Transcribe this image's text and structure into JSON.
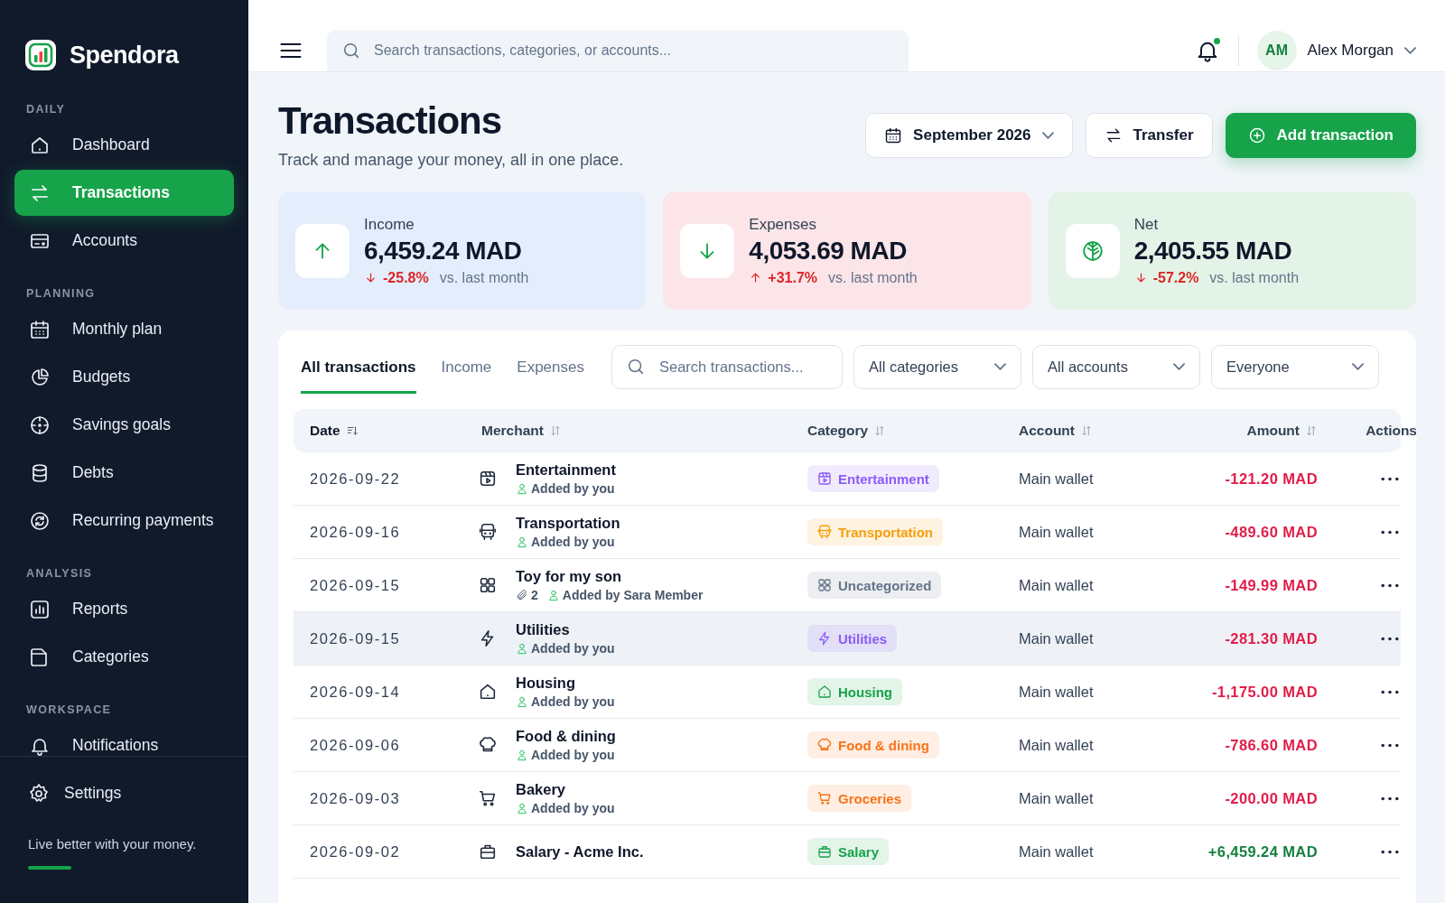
{
  "app": {
    "name": "Spendora",
    "tagline": "Live better with your money."
  },
  "sidebar": {
    "sections": [
      {
        "title": "DAILY",
        "items": [
          {
            "label": "Dashboard",
            "selected": false
          },
          {
            "label": "Transactions",
            "selected": true
          },
          {
            "label": "Accounts",
            "selected": false
          }
        ]
      },
      {
        "title": "PLANNING",
        "items": [
          {
            "label": "Monthly plan",
            "selected": false
          },
          {
            "label": "Budgets",
            "selected": false
          },
          {
            "label": "Savings goals",
            "selected": false
          },
          {
            "label": "Debts",
            "selected": false
          },
          {
            "label": "Recurring payments",
            "selected": false
          }
        ]
      },
      {
        "title": "ANALYSIS",
        "items": [
          {
            "label": "Reports",
            "selected": false
          },
          {
            "label": "Categories",
            "selected": false
          }
        ]
      },
      {
        "title": "WORKSPACE",
        "items": [
          {
            "label": "Notifications",
            "selected": false
          }
        ]
      }
    ],
    "footer_items": [
      {
        "label": "Settings",
        "selected": false
      }
    ]
  },
  "header": {
    "search": {
      "placeholder": "Search transactions, categories, or accounts..."
    },
    "notifications": {
      "unread": true
    },
    "user": {
      "initials": "AM",
      "name": "Alex Morgan"
    }
  },
  "page": {
    "title": "Transactions",
    "subtitle": "Track and manage your money, all in one place.",
    "period": "September 2026",
    "transfer_button": "Transfer",
    "add_button": "Add transaction"
  },
  "summary": [
    {
      "kind": "income",
      "label": "Income",
      "value": "6,459.24 MAD",
      "change": "-25.8%",
      "rising": false,
      "good": false,
      "comparison": "vs. last month"
    },
    {
      "kind": "expenses",
      "label": "Expenses",
      "value": "4,053.69 MAD",
      "change": "+31.7%",
      "rising": true,
      "good": false,
      "comparison": "vs. last month"
    },
    {
      "kind": "net",
      "label": "Net",
      "value": "2,405.55 MAD",
      "change": "-57.2%",
      "rising": false,
      "good": false,
      "comparison": "vs. last month"
    }
  ],
  "tabs": [
    {
      "label": "All transactions",
      "selected": true
    },
    {
      "label": "Income",
      "selected": false
    },
    {
      "label": "Expenses",
      "selected": false
    }
  ],
  "table_search": {
    "placeholder": "Search transactions..."
  },
  "filters": [
    "All categories",
    "All accounts",
    "Everyone"
  ],
  "table": {
    "columns": [
      {
        "label": "Date",
        "sortable": true,
        "sorted": true
      },
      {
        "label": "Merchant",
        "sortable": true,
        "sorted": false
      },
      {
        "label": "Category",
        "sortable": true,
        "sorted": false
      },
      {
        "label": "Account",
        "sortable": true,
        "sorted": false
      },
      {
        "label": "Amount",
        "sortable": true,
        "sorted": false
      },
      {
        "label": "Actions",
        "sortable": false,
        "sorted": false
      }
    ],
    "rows": [
      {
        "date": "2026-09-22",
        "merchant": "Entertainment",
        "added_by": "Added by you",
        "category": "Entertainment",
        "color": "#8b5cf6",
        "account": "Main wallet",
        "amount": "-121.20 MAD",
        "kind": "expense",
        "highlighted": false
      },
      {
        "date": "2026-09-16",
        "merchant": "Transportation",
        "added_by": "Added by you",
        "category": "Transportation",
        "color": "#f59e0b",
        "account": "Main wallet",
        "amount": "-489.60 MAD",
        "kind": "expense",
        "highlighted": false
      },
      {
        "date": "2026-09-15",
        "merchant": "Toy for my son",
        "attachments": "2",
        "added_by": "Added by Sara Member",
        "category": "Uncategorized",
        "color": "#64748b",
        "account": "Main wallet",
        "amount": "-149.99 MAD",
        "kind": "expense",
        "highlighted": false
      },
      {
        "date": "2026-09-15",
        "merchant": "Utilities",
        "added_by": "Added by you",
        "category": "Utilities",
        "color": "#8b5cf6",
        "account": "Main wallet",
        "amount": "-281.30 MAD",
        "kind": "expense",
        "highlighted": true
      },
      {
        "date": "2026-09-14",
        "merchant": "Housing",
        "added_by": "Added by you",
        "category": "Housing",
        "color": "#16a34a",
        "account": "Main wallet",
        "amount": "-1,175.00 MAD",
        "kind": "expense",
        "highlighted": false
      },
      {
        "date": "2026-09-06",
        "merchant": "Food & dining",
        "added_by": "Added by you",
        "category": "Food & dining",
        "color": "#f97316",
        "account": "Main wallet",
        "amount": "-786.60 MAD",
        "kind": "expense",
        "highlighted": false
      },
      {
        "date": "2026-09-03",
        "merchant": "Bakery",
        "added_by": "Added by you",
        "category": "Groceries",
        "color": "#f97316",
        "account": "Main wallet",
        "amount": "-200.00 MAD",
        "kind": "expense",
        "highlighted": false
      },
      {
        "date": "2026-09-02",
        "merchant": "Salary - Acme Inc.",
        "category": "Salary",
        "color": "#16a34a",
        "account": "Main wallet",
        "amount": "+6,459.24 MAD",
        "kind": "income",
        "highlighted": false
      }
    ]
  }
}
